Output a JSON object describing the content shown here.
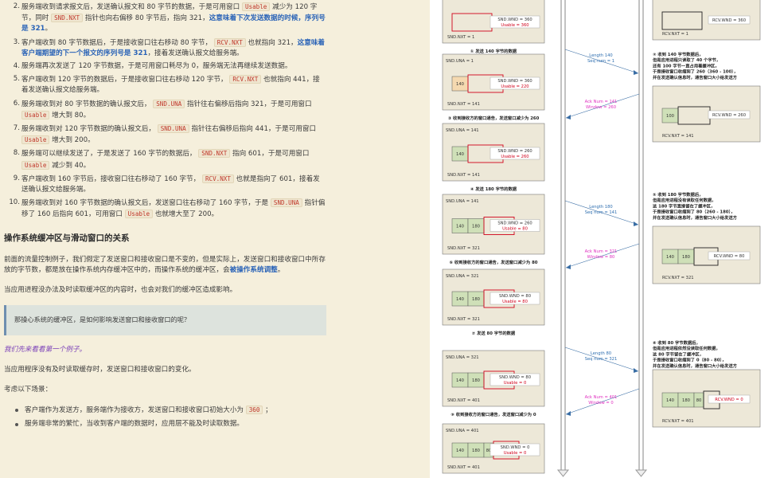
{
  "list_items": [
    {
      "num": "2.",
      "parts": [
        {
          "t": "text",
          "v": "服务端收到请求报文后，发送确认报文和 80 字节的数据，于是可用窗口 "
        },
        {
          "t": "code",
          "v": "Usable"
        },
        {
          "t": "text",
          "v": " 减少为 120 字节，同时 "
        },
        {
          "t": "code",
          "v": "SND.NXT"
        },
        {
          "t": "text",
          "v": " 指针也向右偏移 80 字节后，指向 321，"
        },
        {
          "t": "em",
          "v": "这意味着下次发送数据的时候，序列号是 321"
        },
        {
          "t": "text",
          "v": "。"
        }
      ]
    },
    {
      "num": "3.",
      "parts": [
        {
          "t": "text",
          "v": "客户端收到 80 字节数据后，于是接收窗口往右移动 80 字节， "
        },
        {
          "t": "code",
          "v": "RCV.NXT"
        },
        {
          "t": "text",
          "v": " 也就指向 321，"
        },
        {
          "t": "em",
          "v": "这意味着客户端期望的下一个报文的序列号是 321"
        },
        {
          "t": "text",
          "v": "，接着发送确认报文给服务端。"
        }
      ]
    },
    {
      "num": "4.",
      "parts": [
        {
          "t": "text",
          "v": "服务端再次发送了 120 字节数据，于是可用窗口耗尽为 0，服务端无法再继续发送数据。"
        }
      ]
    },
    {
      "num": "5.",
      "parts": [
        {
          "t": "text",
          "v": "客户端收到 120 字节的数据后，于是接收窗口往右移动 120 字节， "
        },
        {
          "t": "code",
          "v": "RCV.NXT"
        },
        {
          "t": "text",
          "v": " 也就指向 441，接着发送确认报文给服务端。"
        }
      ]
    },
    {
      "num": "6.",
      "parts": [
        {
          "t": "text",
          "v": "服务端收到对 80 字节数据的确认报文后， "
        },
        {
          "t": "code",
          "v": "SND.UNA"
        },
        {
          "t": "text",
          "v": " 指针往右偏移后指向 321，于是可用窗口 "
        },
        {
          "t": "code",
          "v": "Usable"
        },
        {
          "t": "text",
          "v": " 增大到 80。"
        }
      ]
    },
    {
      "num": "7.",
      "parts": [
        {
          "t": "text",
          "v": "服务端收到对 120 字节数据的确认报文后， "
        },
        {
          "t": "code",
          "v": "SND.UNA"
        },
        {
          "t": "text",
          "v": " 指针往右偏移后指向 441，于是可用窗口 "
        },
        {
          "t": "code",
          "v": "Usable"
        },
        {
          "t": "text",
          "v": " 增大到 200。"
        }
      ]
    },
    {
      "num": "8.",
      "parts": [
        {
          "t": "text",
          "v": "服务端可以继续发送了，于是发送了 160 字节的数据后， "
        },
        {
          "t": "code",
          "v": "SND.NXT"
        },
        {
          "t": "text",
          "v": " 指向 601，于是可用窗口 "
        },
        {
          "t": "code",
          "v": "Usable"
        },
        {
          "t": "text",
          "v": " 减少到 40。"
        }
      ]
    },
    {
      "num": "9.",
      "parts": [
        {
          "t": "text",
          "v": "客户端收到 160 字节后，接收窗口往右移动了 160 字节， "
        },
        {
          "t": "code",
          "v": "RCV.NXT"
        },
        {
          "t": "text",
          "v": " 也就是指向了 601，接着发送确认报文给服务端。"
        }
      ]
    },
    {
      "num": "10.",
      "parts": [
        {
          "t": "text",
          "v": "服务端收到对 160 字节数据的确认报文后，发送窗口往右移动了 160 字节，于是 "
        },
        {
          "t": "code",
          "v": "SND.UNA"
        },
        {
          "t": "text",
          "v": " 指针偏移了 160 后指向 601，可用窗口 "
        },
        {
          "t": "code",
          "v": "Usable"
        },
        {
          "t": "text",
          "v": " 也就增大至了 200。"
        }
      ]
    }
  ],
  "section_heading": "操作系统缓冲区与滑动窗口的关系",
  "para1_a": "前面的流量控制例子，我们假定了发送窗口和接收窗口是不变的，但是实际上，发送窗口和接收窗口中所存放的字节数，都是放在操作系统内存缓冲区中的，而操作系统的缓冲区，会",
  "para1_em": "被操作系统调整",
  "para1_b": "。",
  "para2": "当应用进程没办法及时读取缓冲区的内容时，也会对我们的缓冲区造成影响。",
  "quote": "那操心系统的缓冲区，是如何影响发送窗口和接收窗口的呢？",
  "para3": "我们先来看看第一个例子。",
  "para4": "当应用程序没有及时读取缓存时，发送窗口和接收窗口的变化。",
  "para5": "考虑以下场景：",
  "bullets": [
    {
      "parts": [
        {
          "t": "text",
          "v": "客户端作为发送方，服务端作为接收方，发送窗口和接收窗口初始大小为 "
        },
        {
          "t": "code",
          "v": "360"
        },
        {
          "t": "text",
          "v": " ；"
        }
      ]
    },
    {
      "parts": [
        {
          "t": "text",
          "v": "服务端非常的繁忙，当收到客户端的数据时，应用层不能及时读取数据。"
        }
      ]
    }
  ],
  "diagram": {
    "colors": {
      "box_bg": "#ede8d8",
      "box_border": "#777777",
      "red": "#d0021b",
      "pink": "#e030c0",
      "blue": "#2f6fb0",
      "orange": "#f5d9b0",
      "green": "#cfe0b8"
    },
    "left_boxes": [
      {
        "una": "",
        "nxt": "SND.NXT = 1",
        "wnd": "SND.WND = 360",
        "usable": "Usable = 360",
        "cells": [],
        "title": "① 发送 140 字节的数据"
      },
      {
        "una": "SND.UNA = 1",
        "nxt": "SND.NXT = 141",
        "wnd": "SND.WND = 360",
        "usable": "Usable = 220",
        "cells": [
          "140"
        ],
        "title": "③ 收到接收方的窗口通告，发送窗口减少为 260"
      },
      {
        "una": "SND.UNA = 141",
        "nxt": "SND.NXT = 141",
        "wnd": "SND.WND = 260",
        "usable": "Usable = 260",
        "cells": [
          "140"
        ],
        "title": "④ 发送 180 字节的数据"
      },
      {
        "una": "SND.UNA = 141",
        "nxt": "SND.NXT = 321",
        "wnd": "SND.WND = 260",
        "usable": "Usable = 80",
        "cells": [
          "140",
          "180"
        ],
        "title": "⑥ 收到接收方的窗口通告，发送窗口减少为 80"
      },
      {
        "una": "SND.UNA = 321",
        "nxt": "SND.NXT = 321",
        "wnd": "SND.WND = 80",
        "usable": "Usable = 80",
        "cells": [
          "140",
          "180"
        ],
        "title": "⑦ 发送 80 字节的数据"
      },
      {
        "una": "SND.UNA = 321",
        "nxt": "SND.NXT = 401",
        "wnd": "SND.WND = 80",
        "usable": "Usable = 0",
        "cells": [
          "140",
          "180"
        ],
        "title": "⑨ 收到接收方的窗口通告，发送窗口减少为 0"
      },
      {
        "una": "SND.UNA = 401",
        "nxt": "SND.NXT = 401",
        "wnd": "SND.WND = 0",
        "usable": "Usable = 0",
        "cells": [
          "140",
          "180",
          "80"
        ],
        "title": ""
      }
    ],
    "arrows": [
      {
        "label1": "Length 140",
        "label2": "Seq num = 1",
        "dir": "right"
      },
      {
        "label1": "Ack Num = 141",
        "label2": "Window = 260",
        "dir": "left"
      },
      {
        "label1": "Length 180",
        "label2": "Seq num = 141",
        "dir": "right"
      },
      {
        "label1": "Ack Num = 321",
        "label2": "Window = 80",
        "dir": "left"
      },
      {
        "label1": "Length 80",
        "label2": "Seq num = 321",
        "dir": "right"
      },
      {
        "label1": "Ack Num = 401",
        "label2": "Window = 0",
        "dir": "left"
      }
    ],
    "right_notes": [
      {
        "lines": [
          "② 收到 140 字节数据后，",
          "但是应用进程只读取了 40 个字节，",
          "还有 100 字节一直占用着缓冲区，",
          "于是接收窗口收缩到了 260（360 - 100），",
          "并在发送确认信息时，通告窗口大小给发送方"
        ]
      },
      {
        "lines": [
          "⑤ 收到 180 字节数据后，",
          "但是应用进程没有读取任何数据，",
          "这 180 字节直接留在了缓冲区，",
          "于是接收窗口收缩到了 80（260 - 180），",
          "并在发送确认信息时，通告窗口大小给发送方"
        ]
      },
      {
        "lines": [
          "⑧ 收到 80 字节数据后，",
          "但是应用进程依然没读取任何数据，",
          "这 80 字节留在了缓冲区，",
          "于是接收窗口收缩到了 0（80 - 80），",
          "并在发送确认信息时，通告窗口大小给发送方"
        ]
      }
    ],
    "right_boxes": [
      {
        "nxt": "RCV.NXT = 1",
        "wnd": "RCV.WND = 360",
        "cells": []
      },
      {
        "nxt": "RCV.NXT = 141",
        "wnd": "RCV.WND = 260",
        "cells": [
          "100"
        ]
      },
      {
        "nxt": "RCV.NXT = 321",
        "wnd": "RCV.WND = 80",
        "cells": [
          "140",
          "180"
        ]
      },
      {
        "nxt": "RCV.NXT = 401",
        "wnd": "RCV.WND = 0",
        "cells": [
          "140",
          "180",
          "80"
        ]
      }
    ]
  }
}
